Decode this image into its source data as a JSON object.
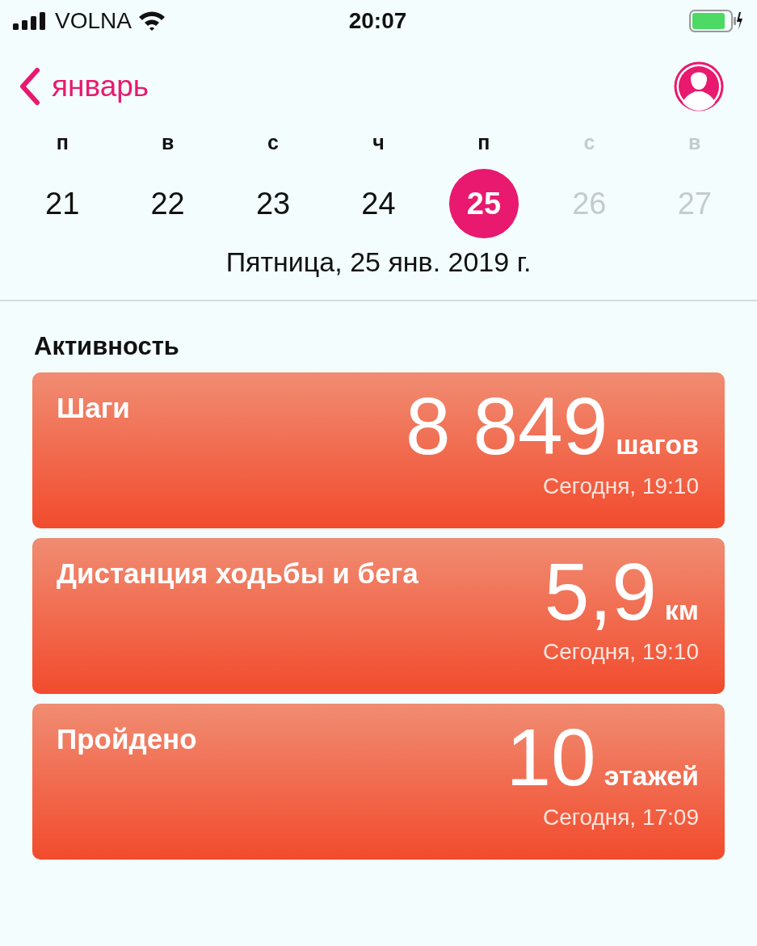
{
  "status_bar": {
    "carrier": "VOLNA",
    "time": "20:07"
  },
  "nav": {
    "back_label": "январь"
  },
  "week": [
    {
      "weekday": "п",
      "date": "21",
      "selected": false,
      "disabled": false
    },
    {
      "weekday": "в",
      "date": "22",
      "selected": false,
      "disabled": false
    },
    {
      "weekday": "с",
      "date": "23",
      "selected": false,
      "disabled": false
    },
    {
      "weekday": "ч",
      "date": "24",
      "selected": false,
      "disabled": false
    },
    {
      "weekday": "п",
      "date": "25",
      "selected": true,
      "disabled": false
    },
    {
      "weekday": "с",
      "date": "26",
      "selected": false,
      "disabled": true
    },
    {
      "weekday": "в",
      "date": "27",
      "selected": false,
      "disabled": true
    }
  ],
  "selected_date": "Пятница, 25 янв. 2019 г.",
  "section_title": "Активность",
  "cards": [
    {
      "title": "Шаги",
      "value": "8 849",
      "unit": "шагов",
      "time": "Сегодня, 19:10"
    },
    {
      "title": "Дистанция ходьбы и бега",
      "value": "5,9",
      "unit": "км",
      "time": "Сегодня, 19:10"
    },
    {
      "title": "Пройдено",
      "value": "10",
      "unit": "этажей",
      "time": "Сегодня, 17:09"
    }
  ]
}
